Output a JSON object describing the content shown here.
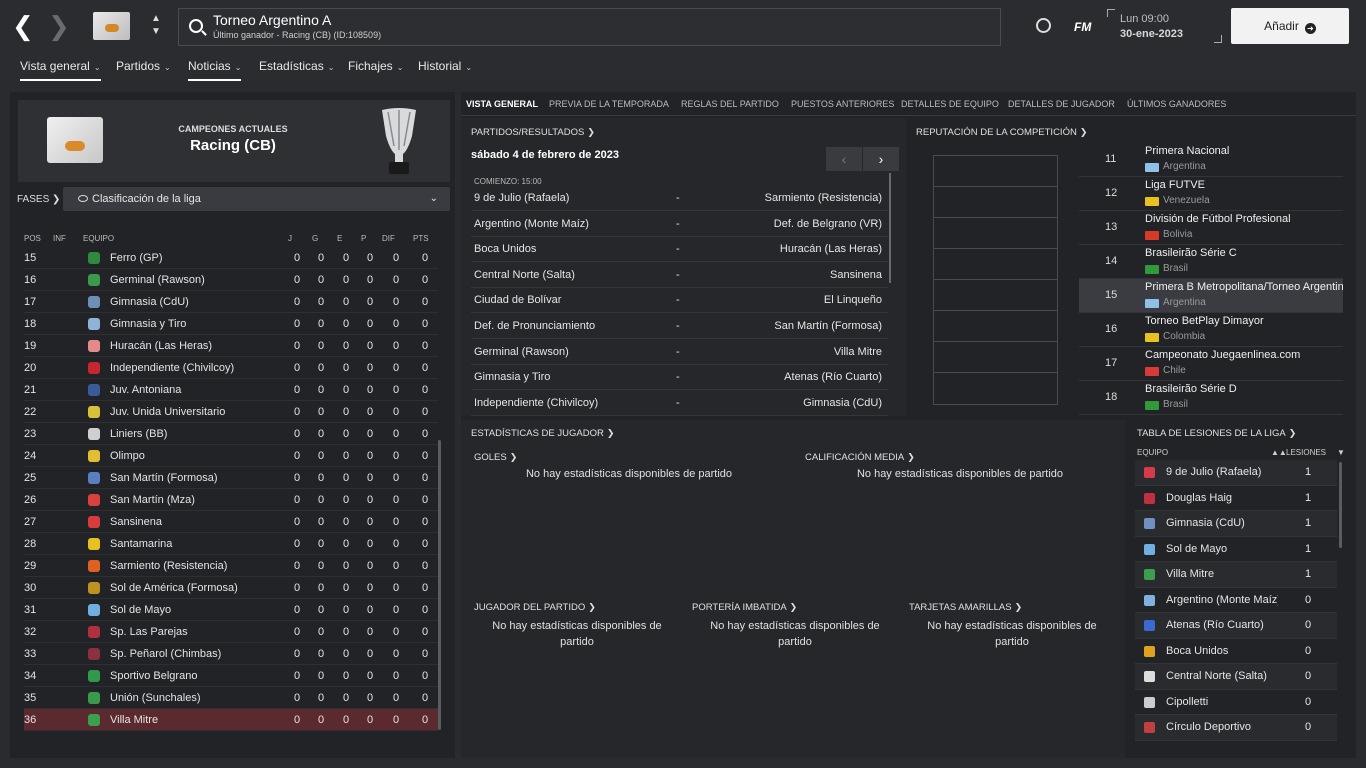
{
  "header": {
    "title": "Torneo Argentino A",
    "subtitle": "Último ganador - Racing (CB) (ID:108509)",
    "day_time": "Lun 09:00",
    "date": "30-ene-2023",
    "add_label": "Añadir",
    "fm_label": "FM",
    "back_icon": "chevron-left-icon",
    "forward_icon": "chevron-right-icon"
  },
  "menu": [
    {
      "label": "Vista general",
      "active": true
    },
    {
      "label": "Partidos",
      "active": false
    },
    {
      "label": "Noticias",
      "active": true
    },
    {
      "label": "Estadísticas",
      "active": false
    },
    {
      "label": "Fichajes",
      "active": false
    },
    {
      "label": "Historial",
      "active": false
    }
  ],
  "champions": {
    "label": "CAMPEONES ACTUALES",
    "team": "Racing (CB)"
  },
  "phases": {
    "label": "FASES",
    "selected": "Clasificación de la liga"
  },
  "table_headers": {
    "pos": "POS",
    "inf": "INF",
    "team": "EQUIPO",
    "j": "J",
    "g": "G",
    "e": "E",
    "p": "P",
    "dif": "DIF",
    "pts": "PTS"
  },
  "standings": [
    {
      "pos": "15",
      "team": "Ferro (GP)",
      "color": "#2e8b3e"
    },
    {
      "pos": "16",
      "team": "Germinal (Rawson)",
      "color": "#3a9a4a"
    },
    {
      "pos": "17",
      "team": "Gimnasia (CdU)",
      "color": "#6f8fb8"
    },
    {
      "pos": "18",
      "team": "Gimnasia y Tiro",
      "color": "#8fb3d9"
    },
    {
      "pos": "19",
      "team": "Huracán (Las Heras)",
      "color": "#e58a8a"
    },
    {
      "pos": "20",
      "team": "Independiente (Chivilcoy)",
      "color": "#c8262f"
    },
    {
      "pos": "21",
      "team": "Juv. Antoniana",
      "color": "#3a5a9a"
    },
    {
      "pos": "22",
      "team": "Juv. Unida Universitario",
      "color": "#d9c23a"
    },
    {
      "pos": "23",
      "team": "Liniers (BB)",
      "color": "#cfcfcf"
    },
    {
      "pos": "24",
      "team": "Olimpo",
      "color": "#e0c030"
    },
    {
      "pos": "25",
      "team": "San Martín (Formosa)",
      "color": "#5a7fc0"
    },
    {
      "pos": "26",
      "team": "San Martín (Mza)",
      "color": "#d94040"
    },
    {
      "pos": "27",
      "team": "Sansinena",
      "color": "#d93a3a"
    },
    {
      "pos": "28",
      "team": "Santamarina",
      "color": "#e8c020"
    },
    {
      "pos": "29",
      "team": "Sarmiento (Resistencia)",
      "color": "#e06020"
    },
    {
      "pos": "30",
      "team": "Sol de América (Formosa)",
      "color": "#c09020"
    },
    {
      "pos": "31",
      "team": "Sol de Mayo",
      "color": "#6fb0e0"
    },
    {
      "pos": "32",
      "team": "Sp. Las Parejas",
      "color": "#b03040"
    },
    {
      "pos": "33",
      "team": "Sp. Peñarol (Chimbas)",
      "color": "#8a3040"
    },
    {
      "pos": "34",
      "team": "Sportivo Belgrano",
      "color": "#2e9a4a"
    },
    {
      "pos": "35",
      "team": "Unión (Sunchales)",
      "color": "#3a9a4a"
    },
    {
      "pos": "36",
      "team": "Villa Mitre",
      "color": "#3aa050",
      "highlight": true
    }
  ],
  "tabs": [
    "VISTA GENERAL",
    "PREVIA DE LA TEMPORADA",
    "REGLAS DEL PARTIDO",
    "PUESTOS ANTERIORES",
    "DETALLES DE EQUIPO",
    "DETALLES DE JUGADOR",
    "ÚLTIMOS GANADORES"
  ],
  "matches": {
    "header": "PARTIDOS/RESULTADOS",
    "date": "sábado 4 de febrero de 2023",
    "kickoff": "COMIENZO: 15:00",
    "dash": "-",
    "list": [
      {
        "home": "9 de Julio (Rafaela)",
        "away": "Sarmiento (Resistencia)"
      },
      {
        "home": "Argentino (Monte Maíz)",
        "away": "Def. de Belgrano (VR)"
      },
      {
        "home": "Boca Unidos",
        "away": "Huracán (Las Heras)"
      },
      {
        "home": "Central Norte (Salta)",
        "away": "Sansinena"
      },
      {
        "home": "Ciudad de Bolívar",
        "away": "El Linqueño"
      },
      {
        "home": "Def. de Pronunciamiento",
        "away": "San Martín (Formosa)"
      },
      {
        "home": "Germinal (Rawson)",
        "away": "Villa Mitre"
      },
      {
        "home": "Gimnasia y Tiro",
        "away": "Atenas (Río Cuarto)"
      },
      {
        "home": "Independiente (Chivilcoy)",
        "away": "Gimnasia (CdU)"
      }
    ]
  },
  "reputation": {
    "header": "REPUTACIÓN DE LA COMPETICIÓN",
    "list": [
      {
        "rank": "11",
        "name": "Primera Nacional",
        "country": "Argentina",
        "flag": "#8fc0e8"
      },
      {
        "rank": "12",
        "name": "Liga FUTVE",
        "country": "Venezuela",
        "flag": "#e8c020"
      },
      {
        "rank": "13",
        "name": "División de Fútbol Profesional",
        "country": "Bolivia",
        "flag": "#d83a2a"
      },
      {
        "rank": "14",
        "name": "Brasileirão Série C",
        "country": "Brasil",
        "flag": "#2e9a3a"
      },
      {
        "rank": "15",
        "name": "Primera B Metropolitana/Torneo Argentino A",
        "country": "Argentina",
        "flag": "#8fc0e8",
        "highlight": true
      },
      {
        "rank": "16",
        "name": "Torneo BetPlay Dimayor",
        "country": "Colombia",
        "flag": "#e8c020"
      },
      {
        "rank": "17",
        "name": "Campeonato Juegaenlinea.com",
        "country": "Chile",
        "flag": "#d83a3a"
      },
      {
        "rank": "18",
        "name": "Brasileirão Série D",
        "country": "Brasil",
        "flag": "#2e9a3a"
      }
    ]
  },
  "player_stats": {
    "header": "ESTADÍSTICAS DE JUGADOR",
    "goals": "GOLES",
    "rating": "CALIFICACIÓN MEDIA",
    "motm": "JUGADOR DEL PARTIDO",
    "clean": "PORTERÍA IMBATIDA",
    "yellow": "TARJETAS AMARILLAS",
    "none": "No hay estadísticas disponibles de partido"
  },
  "injuries": {
    "header": "TABLA DE LESIONES DE LA LIGA",
    "col_team": "EQUIPO",
    "col_inj": "LESIONES",
    "list": [
      {
        "team": "9 de Julio (Rafaela)",
        "n": "1",
        "color": "#d83a4a"
      },
      {
        "team": "Douglas Haig",
        "n": "1",
        "color": "#c03040"
      },
      {
        "team": "Gimnasia (CdU)",
        "n": "1",
        "color": "#7090c0"
      },
      {
        "team": "Sol de Mayo",
        "n": "1",
        "color": "#6fb0e0"
      },
      {
        "team": "Villa Mitre",
        "n": "1",
        "color": "#3aa050"
      },
      {
        "team": "Argentino (Monte Maíz)",
        "n": "0",
        "color": "#7fb0e0"
      },
      {
        "team": "Atenas (Río Cuarto)",
        "n": "0",
        "color": "#3a6ad0"
      },
      {
        "team": "Boca Unidos",
        "n": "0",
        "color": "#e0a020"
      },
      {
        "team": "Central Norte (Salta)",
        "n": "0",
        "color": "#dddddd"
      },
      {
        "team": "Cipolletti",
        "n": "0",
        "color": "#cccccc"
      },
      {
        "team": "Círculo Deportivo",
        "n": "0",
        "color": "#c04040"
      }
    ]
  }
}
